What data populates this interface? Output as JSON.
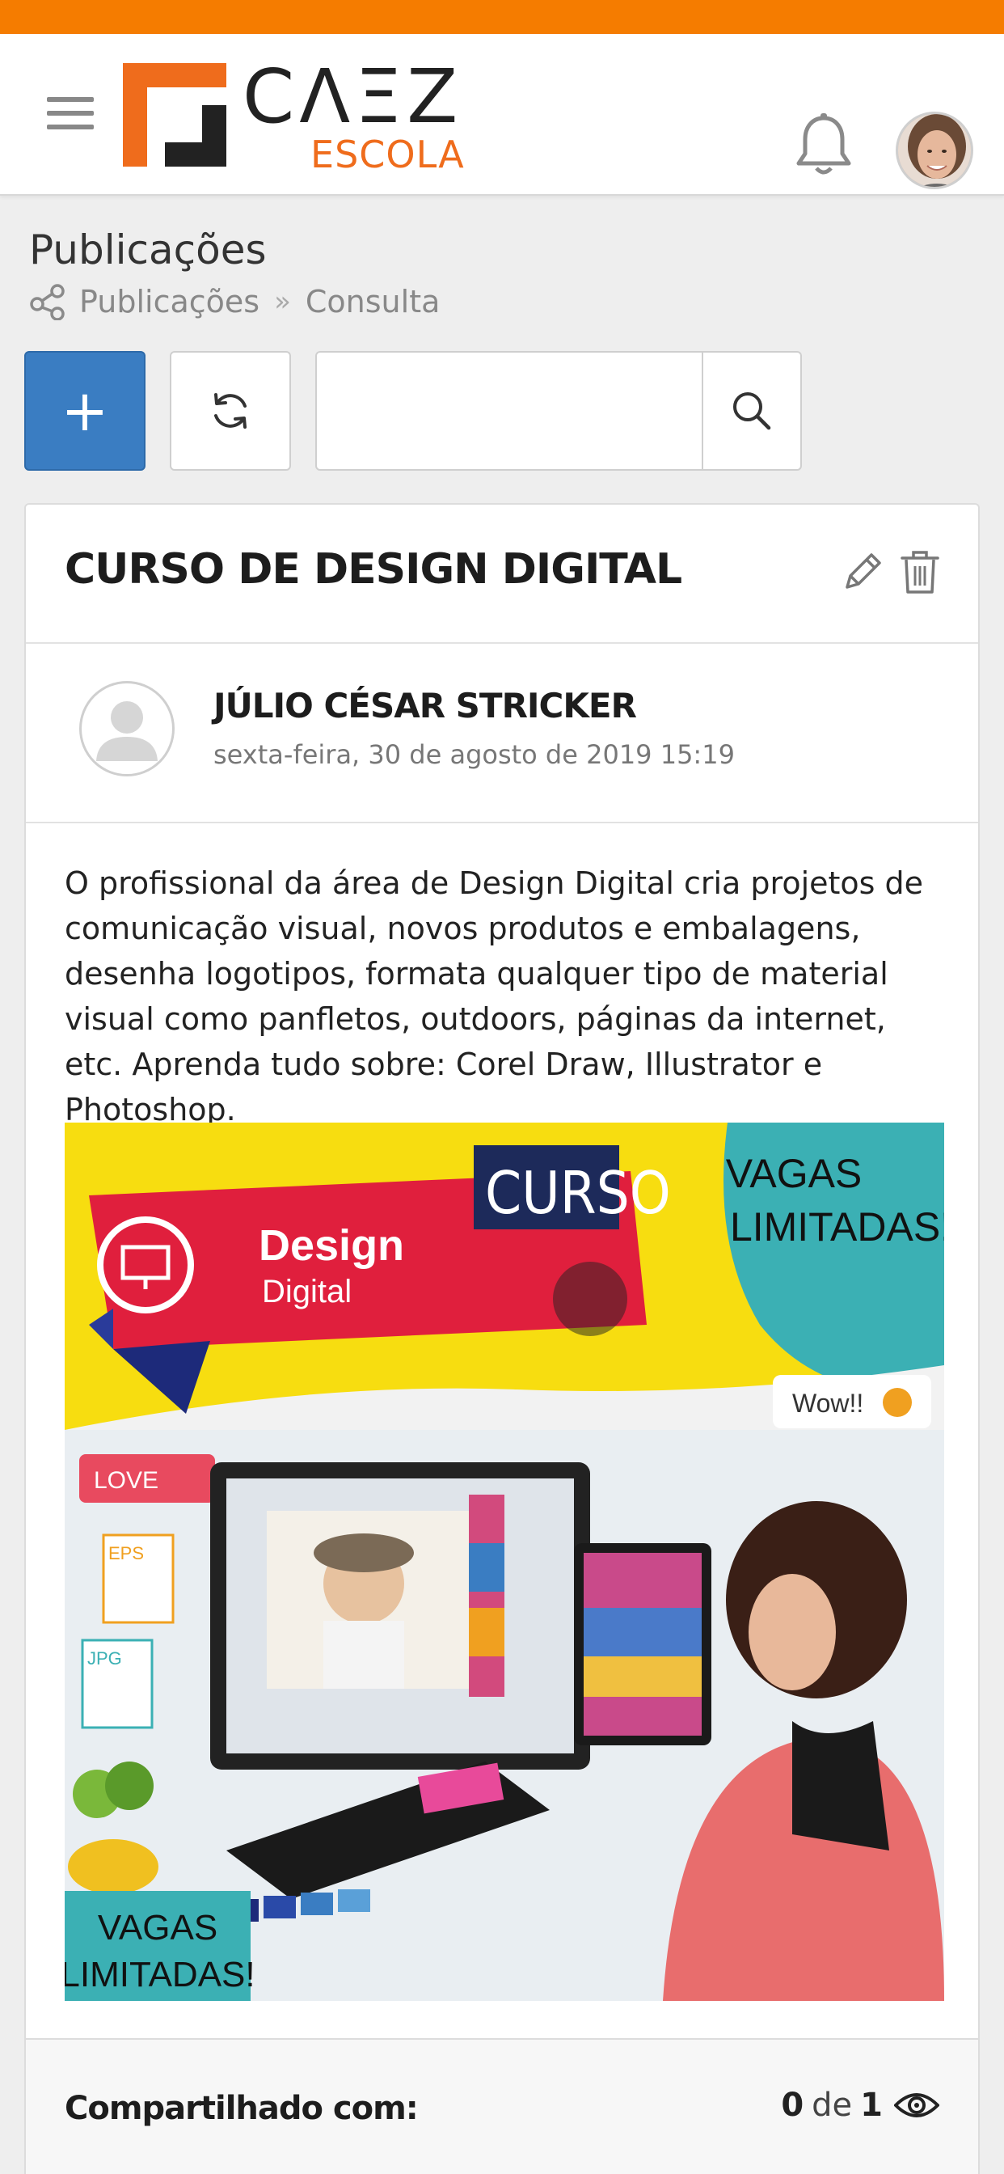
{
  "app": {
    "logo_word": "CΛΞZ",
    "logo_sub": "ESCOLA",
    "brand_color": "#f57c00",
    "accent_color": "#3a7dc2"
  },
  "page": {
    "title": "Publicações",
    "breadcrumb": [
      "Publicações",
      "Consulta"
    ]
  },
  "toolbar": {
    "add_label": "+",
    "search_value": ""
  },
  "post": {
    "title": "CURSO DE DESIGN DIGITAL",
    "author": "JÚLIO CÉSAR STRICKER",
    "date": "sexta-feira, 30 de agosto de 2019 15:19",
    "body": "O profissional da área de Design Digital cria projetos de comunicação visual, novos produtos e embalagens, desenha logotipos, formata qualquer tipo de material visual como panfletos, outdoors, páginas da internet, etc. Aprenda tudo sobre: Corel Draw, Illustrator e Photoshop.",
    "image": {
      "banner_curso": "CURSO",
      "banner_design": "Design",
      "banner_digital": "Digital",
      "vagas_1": "VAGAS",
      "limitadas_1": "LIMITADAS!",
      "wow": "Wow!!",
      "love": "LOVE",
      "eps": "EPS",
      "jpg": "JPG",
      "vagas_2": "VAGAS",
      "limitadas_2": "LIMITADAS!"
    },
    "footer": {
      "shared_label": "Compartilhado com:",
      "count": "0",
      "of": "de",
      "total": "1"
    }
  },
  "icons": {
    "menu": "hamburger-icon",
    "notifications": "bell-icon",
    "breadcrumb": "share-icon",
    "refresh": "refresh-icon",
    "search": "search-icon",
    "edit": "pencil-icon",
    "delete": "trash-icon",
    "views": "eye-icon"
  }
}
